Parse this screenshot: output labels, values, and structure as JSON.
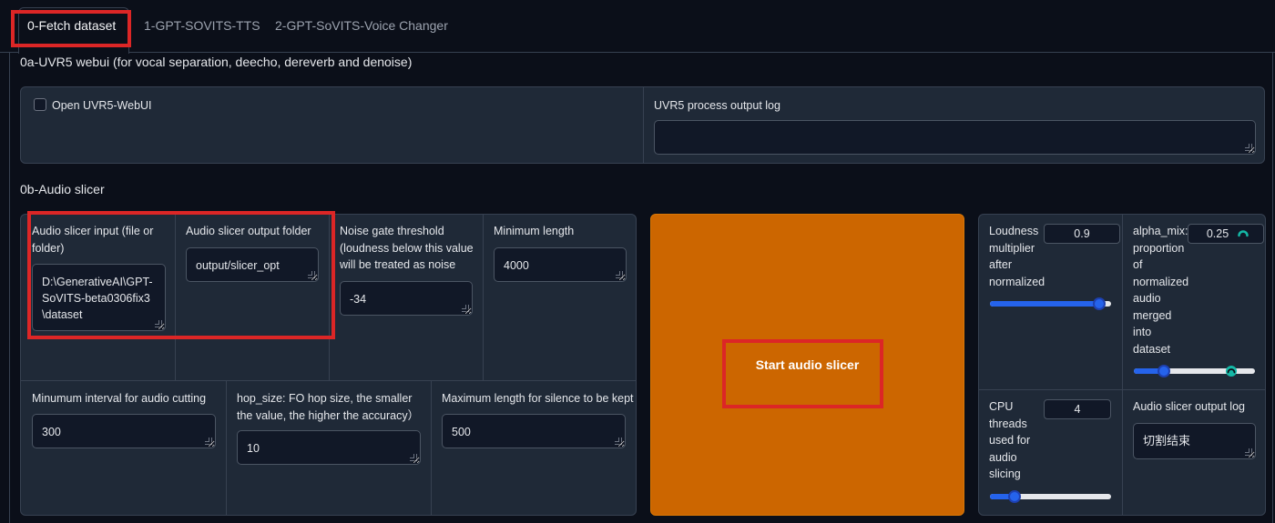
{
  "tabs": [
    {
      "label": "0-Fetch dataset",
      "active": true
    },
    {
      "label": "1-GPT-SOVITS-TTS",
      "active": false
    },
    {
      "label": "2-GPT-SoVITS-Voice Changer",
      "active": false
    }
  ],
  "uvr": {
    "section_title": "0a-UVR5 webui (for vocal separation, deecho, dereverb and denoise)",
    "open_label": "Open UVR5-WebUI",
    "open_checked": false,
    "log_label": "UVR5 process output log",
    "log_value": ""
  },
  "slicer": {
    "section_title": "0b-Audio slicer",
    "input_label": "Audio slicer input (file or folder)",
    "input_value": "D:\\GenerativeAI\\GPT-SoVITS-beta0306fix3\\dataset",
    "output_folder_label": "Audio slicer output folder",
    "output_folder_value": "output/slicer_opt",
    "threshold_label": "Noise gate threshold (loudness below this value will be treated as noise",
    "threshold_value": "-34",
    "min_length_label": "Minimum length",
    "min_length_value": "4000",
    "min_interval_label": "Minumum interval for audio cutting",
    "min_interval_value": "300",
    "hop_size_label": "hop_size: FO hop size, the smaller the value, the higher the accuracy）",
    "hop_size_value": "10",
    "max_sil_label": "Maximum length for silence to be kept",
    "max_sil_value": "500",
    "start_button": "Start audio slicer",
    "loudness_label": "Loudness multiplier after normalized",
    "loudness_value": "0.9",
    "loudness_fraction": 0.9,
    "alpha_label": "alpha_mix: proportion of normalized audio merged into dataset",
    "alpha_value": "0.25",
    "alpha_fraction": 0.25,
    "cpu_label": "CPU threads used for audio slicing",
    "cpu_value": "4",
    "cpu_fraction": 0.2,
    "log_label": "Audio slicer output log",
    "log_value": "切割结束"
  },
  "colors": {
    "accent": "#2563eb",
    "button": "#cc6600",
    "highlight": "#dc2626",
    "loading_indicator": "#14b8a6"
  }
}
